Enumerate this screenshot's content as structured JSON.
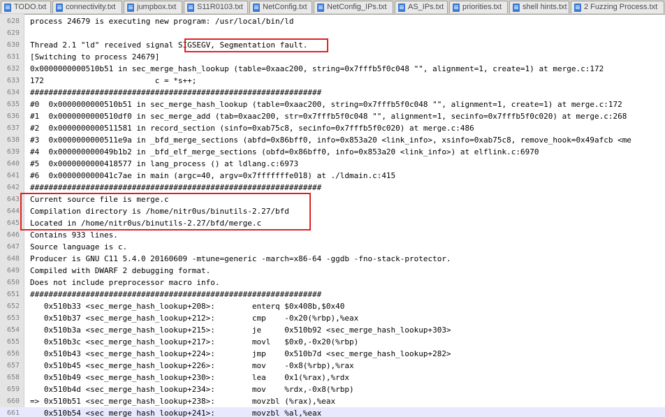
{
  "tabs": [
    {
      "label": "TODO.txt"
    },
    {
      "label": "connectivity.txt"
    },
    {
      "label": "jumpbox.txt"
    },
    {
      "label": "S11R0103.txt"
    },
    {
      "label": "NetConfig.txt"
    },
    {
      "label": "NetConfig_IPs.txt"
    },
    {
      "label": "AS_IPs.txt"
    },
    {
      "label": "priorities.txt"
    },
    {
      "label": "shell hints.txt"
    },
    {
      "label": "2 Fuzzing Process.txt"
    }
  ],
  "lines": [
    {
      "n": "628",
      "text": "process 24679 is executing new program: /usr/local/bin/ld"
    },
    {
      "n": "629",
      "text": ""
    },
    {
      "n": "630",
      "text": "Thread 2.1 \"ld\" received signal SIGSEGV, Segmentation fault."
    },
    {
      "n": "631",
      "text": "[Switching to process 24679]"
    },
    {
      "n": "632",
      "text": "0x0000000000510b51 in sec_merge_hash_lookup (table=0xaac200, string=0x7fffb5f0c048 \"\", alignment=1, create=1) at merge.c:172"
    },
    {
      "n": "633",
      "text": "172                        c = *s++;"
    },
    {
      "n": "634",
      "text": "###############################################################"
    },
    {
      "n": "635",
      "text": "#0  0x0000000000510b51 in sec_merge_hash_lookup (table=0xaac200, string=0x7fffb5f0c048 \"\", alignment=1, create=1) at merge.c:172"
    },
    {
      "n": "636",
      "text": "#1  0x0000000000510df0 in sec_merge_add (tab=0xaac200, str=0x7fffb5f0c048 \"\", alignment=1, secinfo=0x7fffb5f0c020) at merge.c:268"
    },
    {
      "n": "637",
      "text": "#2  0x0000000000511581 in record_section (sinfo=0xab75c8, secinfo=0x7fffb5f0c020) at merge.c:486"
    },
    {
      "n": "638",
      "text": "#3  0x0000000000511e9a in _bfd_merge_sections (abfd=0x86bff0, info=0x853a20 <link_info>, xsinfo=0xab75c8, remove_hook=0x49afcb <me"
    },
    {
      "n": "639",
      "text": "#4  0x000000000049b1b2 in _bfd_elf_merge_sections (obfd=0x86bff0, info=0x853a20 <link_info>) at elflink.c:6970"
    },
    {
      "n": "640",
      "text": "#5  0x0000000000418577 in lang_process () at ldlang.c:6973"
    },
    {
      "n": "641",
      "text": "#6  0x000000000041c7ae in main (argc=40, argv=0x7fffffffe018) at ./ldmain.c:415"
    },
    {
      "n": "642",
      "text": "###############################################################"
    },
    {
      "n": "643",
      "text": "Current source file is merge.c"
    },
    {
      "n": "644",
      "text": "Compilation directory is /home/nitr0us/binutils-2.27/bfd"
    },
    {
      "n": "645",
      "text": "Located in /home/nitr0us/binutils-2.27/bfd/merge.c"
    },
    {
      "n": "646",
      "text": "Contains 933 lines."
    },
    {
      "n": "647",
      "text": "Source language is c."
    },
    {
      "n": "648",
      "text": "Producer is GNU C11 5.4.0 20160609 -mtune=generic -march=x86-64 -ggdb -fno-stack-protector."
    },
    {
      "n": "649",
      "text": "Compiled with DWARF 2 debugging format."
    },
    {
      "n": "650",
      "text": "Does not include preprocessor macro info."
    },
    {
      "n": "651",
      "text": "###############################################################"
    },
    {
      "n": "652",
      "text": "   0x510b33 <sec_merge_hash_lookup+208>:        enterq $0x408b,$0x40"
    },
    {
      "n": "653",
      "text": "   0x510b37 <sec_merge_hash_lookup+212>:        cmp    -0x20(%rbp),%eax"
    },
    {
      "n": "654",
      "text": "   0x510b3a <sec_merge_hash_lookup+215>:        je     0x510b92 <sec_merge_hash_lookup+303>"
    },
    {
      "n": "655",
      "text": "   0x510b3c <sec_merge_hash_lookup+217>:        movl   $0x0,-0x20(%rbp)"
    },
    {
      "n": "656",
      "text": "   0x510b43 <sec_merge_hash_lookup+224>:        jmp    0x510b7d <sec_merge_hash_lookup+282>"
    },
    {
      "n": "657",
      "text": "   0x510b45 <sec_merge_hash_lookup+226>:        mov    -0x8(%rbp),%rax"
    },
    {
      "n": "658",
      "text": "   0x510b49 <sec_merge_hash_lookup+230>:        lea    0x1(%rax),%rdx"
    },
    {
      "n": "659",
      "text": "   0x510b4d <sec_merge_hash_lookup+234>:        mov    %rdx,-0x8(%rbp)"
    },
    {
      "n": "660",
      "text": "=> 0x510b51 <sec_merge_hash_lookup+238>:        movzbl (%rax),%eax"
    },
    {
      "n": "661",
      "text": "   0x510b54 <sec_merge_hash_lookup+241>:        movzbl %al,%eax"
    }
  ],
  "current_line": "661"
}
